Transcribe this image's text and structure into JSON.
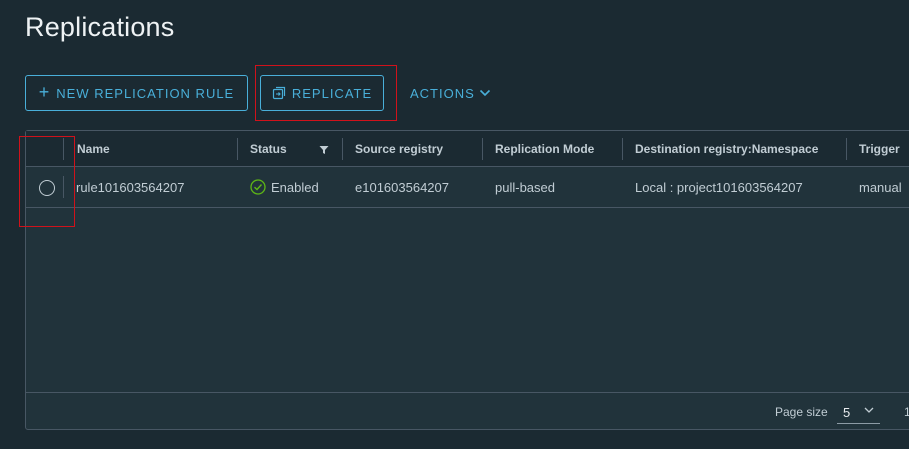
{
  "page": {
    "title": "Replications"
  },
  "toolbar": {
    "new_rule_label": "NEW REPLICATION RULE",
    "replicate_label": "REPLICATE",
    "actions_label": "ACTIONS"
  },
  "table": {
    "columns": [
      "Name",
      "Status",
      "Source registry",
      "Replication Mode",
      "Destination registry:Namespace",
      "Trigger"
    ],
    "rows": [
      {
        "name": "rule101603564207",
        "status": "Enabled",
        "source_registry": "e101603564207",
        "replication_mode": "pull-based",
        "destination": "Local : project101603564207",
        "trigger": "manual"
      }
    ]
  },
  "footer": {
    "page_size_label": "Page size",
    "page_size_value": "5",
    "page_number": "1"
  },
  "colors": {
    "accent": "#49afd9",
    "status_ok": "#5eb715",
    "highlight": "#d0121b",
    "background": "#1b2a32"
  },
  "icons": {
    "plus": "plus-icon",
    "replicate": "copy-icon",
    "actions": "chevron-down-icon",
    "status_filter": "filter-icon",
    "status": "check-circle-icon"
  }
}
